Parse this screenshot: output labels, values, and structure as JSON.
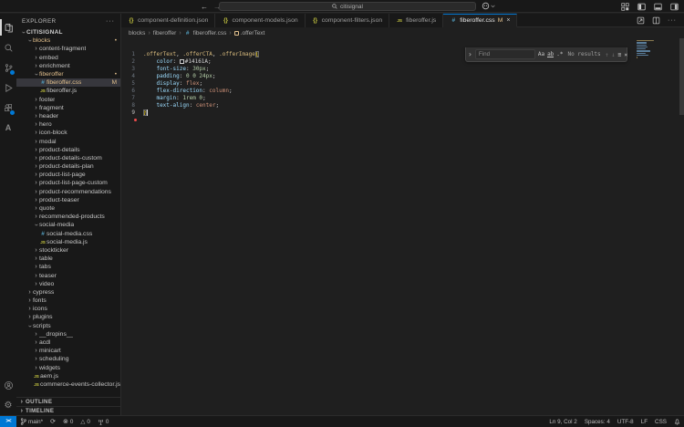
{
  "colors": {
    "accent": "#0078d4",
    "modified_gold": "#e2c08d",
    "error_red": "#f14c4c",
    "selector_gold": "#d7ba7d",
    "property_blue": "#9cdcfe",
    "number_green": "#b5cea8",
    "keyword_orange": "#ce9178",
    "bracket_gold": "#ffd700",
    "css_icon_blue": "#519aba",
    "js_icon_yellow": "#cbcb41",
    "swatch_value": "#14161A"
  },
  "titlebar": {
    "search_value": "citisignal",
    "back_arrow": "←",
    "forward_arrow": "→"
  },
  "activity_bar": {
    "items": [
      {
        "name": "explorer",
        "active": true,
        "badge": false
      },
      {
        "name": "search",
        "active": false,
        "badge": false
      },
      {
        "name": "source-control",
        "active": false,
        "badge": true
      },
      {
        "name": "run-and-debug",
        "active": false,
        "badge": false
      },
      {
        "name": "extensions",
        "active": false,
        "badge": true
      },
      {
        "name": "aem-extension",
        "active": false,
        "badge": false
      }
    ],
    "bottom": [
      {
        "name": "accounts"
      },
      {
        "name": "settings"
      }
    ]
  },
  "explorer": {
    "title": "EXPLORER",
    "more_actions": "···",
    "tree": [
      {
        "label": "CITISIGNAL",
        "depth": 0,
        "type": "root",
        "expanded": true
      },
      {
        "label": "blocks",
        "depth": 1,
        "type": "folder",
        "expanded": true,
        "modified": true,
        "badge": "dot"
      },
      {
        "label": "content-fragment",
        "depth": 2,
        "type": "folder"
      },
      {
        "label": "embed",
        "depth": 2,
        "type": "folder"
      },
      {
        "label": "enrichment",
        "depth": 2,
        "type": "folder"
      },
      {
        "label": "fiberoffer",
        "depth": 2,
        "type": "folder",
        "expanded": true,
        "modified": true,
        "badge": "dot"
      },
      {
        "label": "fiberoffer.css",
        "depth": 3,
        "type": "file",
        "icon": "css",
        "modified": true,
        "badge": "M",
        "selected": true
      },
      {
        "label": "fiberoffer.js",
        "depth": 3,
        "type": "file",
        "icon": "js"
      },
      {
        "label": "footer",
        "depth": 2,
        "type": "folder"
      },
      {
        "label": "fragment",
        "depth": 2,
        "type": "folder"
      },
      {
        "label": "header",
        "depth": 2,
        "type": "folder"
      },
      {
        "label": "hero",
        "depth": 2,
        "type": "folder"
      },
      {
        "label": "icon-block",
        "depth": 2,
        "type": "folder"
      },
      {
        "label": "modal",
        "depth": 2,
        "type": "folder"
      },
      {
        "label": "product-details",
        "depth": 2,
        "type": "folder"
      },
      {
        "label": "product-details-custom",
        "depth": 2,
        "type": "folder"
      },
      {
        "label": "product-details-plan",
        "depth": 2,
        "type": "folder"
      },
      {
        "label": "product-list-page",
        "depth": 2,
        "type": "folder"
      },
      {
        "label": "product-list-page-custom",
        "depth": 2,
        "type": "folder"
      },
      {
        "label": "product-recommendations",
        "depth": 2,
        "type": "folder"
      },
      {
        "label": "product-teaser",
        "depth": 2,
        "type": "folder"
      },
      {
        "label": "quote",
        "depth": 2,
        "type": "folder"
      },
      {
        "label": "recommended-products",
        "depth": 2,
        "type": "folder"
      },
      {
        "label": "social-media",
        "depth": 2,
        "type": "folder",
        "expanded": true
      },
      {
        "label": "social-media.css",
        "depth": 3,
        "type": "file",
        "icon": "css"
      },
      {
        "label": "social-media.js",
        "depth": 3,
        "type": "file",
        "icon": "js"
      },
      {
        "label": "stockticker",
        "depth": 2,
        "type": "folder"
      },
      {
        "label": "table",
        "depth": 2,
        "type": "folder"
      },
      {
        "label": "tabs",
        "depth": 2,
        "type": "folder"
      },
      {
        "label": "teaser",
        "depth": 2,
        "type": "folder"
      },
      {
        "label": "video",
        "depth": 2,
        "type": "folder"
      },
      {
        "label": "cypress",
        "depth": 1,
        "type": "folder"
      },
      {
        "label": "fonts",
        "depth": 1,
        "type": "folder"
      },
      {
        "label": "icons",
        "depth": 1,
        "type": "folder"
      },
      {
        "label": "plugins",
        "depth": 1,
        "type": "folder"
      },
      {
        "label": "scripts",
        "depth": 1,
        "type": "folder",
        "expanded": true
      },
      {
        "label": "__dropins__",
        "depth": 2,
        "type": "folder"
      },
      {
        "label": "acdl",
        "depth": 2,
        "type": "folder"
      },
      {
        "label": "minicart",
        "depth": 2,
        "type": "folder"
      },
      {
        "label": "scheduling",
        "depth": 2,
        "type": "folder"
      },
      {
        "label": "widgets",
        "depth": 2,
        "type": "folder"
      },
      {
        "label": "aem.js",
        "depth": 2,
        "type": "file",
        "icon": "js"
      },
      {
        "label": "commerce-events-collector.js",
        "depth": 2,
        "type": "file",
        "icon": "js"
      }
    ],
    "sections": [
      "OUTLINE",
      "TIMELINE"
    ]
  },
  "tabs": [
    {
      "label": "component-definition.json",
      "icon": "json",
      "active": false
    },
    {
      "label": "component-models.json",
      "icon": "json",
      "active": false
    },
    {
      "label": "component-filters.json",
      "icon": "json",
      "active": false
    },
    {
      "label": "fiberoffer.js",
      "icon": "js",
      "active": false
    },
    {
      "label": "fiberoffer.css",
      "icon": "css",
      "active": true,
      "git_badge": "M",
      "close": "×"
    }
  ],
  "tab_actions": {
    "more": "···"
  },
  "breadcrumb": [
    {
      "label": "blocks"
    },
    {
      "label": "fiberoffer"
    },
    {
      "label": "fiberoffer.css",
      "icon": "css"
    },
    {
      "label": ".offerText",
      "icon": "symbol"
    }
  ],
  "find": {
    "placeholder": "Find",
    "results": "No results",
    "match_case": "Aa",
    "whole_word": "ab",
    "regex": ".*",
    "prev": "↑",
    "next": "↓",
    "in_selection": "≡",
    "close": "×",
    "toggle": "›"
  },
  "editor": {
    "lines": [
      [
        {
          "t": ".offerText",
          "c": "sel"
        },
        {
          "t": ",",
          "c": "pun"
        },
        {
          "t": " "
        },
        {
          "t": ".offerCTA",
          "c": "sel"
        },
        {
          "t": ",",
          "c": "pun"
        },
        {
          "t": " "
        },
        {
          "t": ".offerImage",
          "c": "sel"
        },
        {
          "t": "{",
          "c": "brk",
          "m": true
        }
      ],
      [
        {
          "t": "    "
        },
        {
          "t": "color",
          "c": "prop"
        },
        {
          "t": ": ",
          "c": "pun"
        },
        {
          "sp": "swatch"
        },
        {
          "t": "#14161A",
          "c": "hex"
        },
        {
          "t": ";",
          "c": "pun"
        }
      ],
      [
        {
          "t": "    "
        },
        {
          "t": "font-size",
          "c": "prop"
        },
        {
          "t": ": ",
          "c": "pun"
        },
        {
          "t": "30px",
          "c": "num"
        },
        {
          "t": ";",
          "c": "pun"
        }
      ],
      [
        {
          "t": "    "
        },
        {
          "t": "padding",
          "c": "prop"
        },
        {
          "t": ": ",
          "c": "pun"
        },
        {
          "t": "0 0 24px",
          "c": "num"
        },
        {
          "t": ";",
          "c": "pun"
        }
      ],
      [
        {
          "t": "    "
        },
        {
          "t": "display",
          "c": "prop"
        },
        {
          "t": ": ",
          "c": "pun"
        },
        {
          "t": "flex",
          "c": "kw"
        },
        {
          "t": ";",
          "c": "pun"
        }
      ],
      [
        {
          "t": "    "
        },
        {
          "t": "flex-direction",
          "c": "prop"
        },
        {
          "t": ": ",
          "c": "pun"
        },
        {
          "t": "column",
          "c": "kw"
        },
        {
          "t": ";",
          "c": "pun"
        }
      ],
      [
        {
          "t": "    "
        },
        {
          "t": "margin",
          "c": "prop"
        },
        {
          "t": ": ",
          "c": "pun"
        },
        {
          "t": "1rem 0",
          "c": "num"
        },
        {
          "t": ";",
          "c": "pun"
        }
      ],
      [
        {
          "t": "    "
        },
        {
          "t": "text-align",
          "c": "prop"
        },
        {
          "t": ": ",
          "c": "pun"
        },
        {
          "t": "center",
          "c": "kw"
        },
        {
          "t": ";",
          "c": "pun"
        }
      ],
      [
        {
          "t": "}",
          "c": "brk",
          "m": true
        },
        {
          "sp": "cursor"
        }
      ]
    ],
    "active_line": 9
  },
  "status_bar": {
    "left": [
      {
        "name": "remote-indicator",
        "label": ""
      },
      {
        "name": "git-branch",
        "label": "main*"
      },
      {
        "name": "sync",
        "label": ""
      },
      {
        "name": "errors",
        "label": "0"
      },
      {
        "name": "warnings",
        "label": "0"
      },
      {
        "name": "ports",
        "label": "0"
      }
    ],
    "right": [
      {
        "name": "cursor-position",
        "label": "Ln 9, Col 2"
      },
      {
        "name": "indentation",
        "label": "Spaces: 4"
      },
      {
        "name": "encoding",
        "label": "UTF-8"
      },
      {
        "name": "eol",
        "label": "LF"
      },
      {
        "name": "language-mode",
        "label": "CSS"
      },
      {
        "name": "notifications",
        "label": ""
      }
    ]
  }
}
